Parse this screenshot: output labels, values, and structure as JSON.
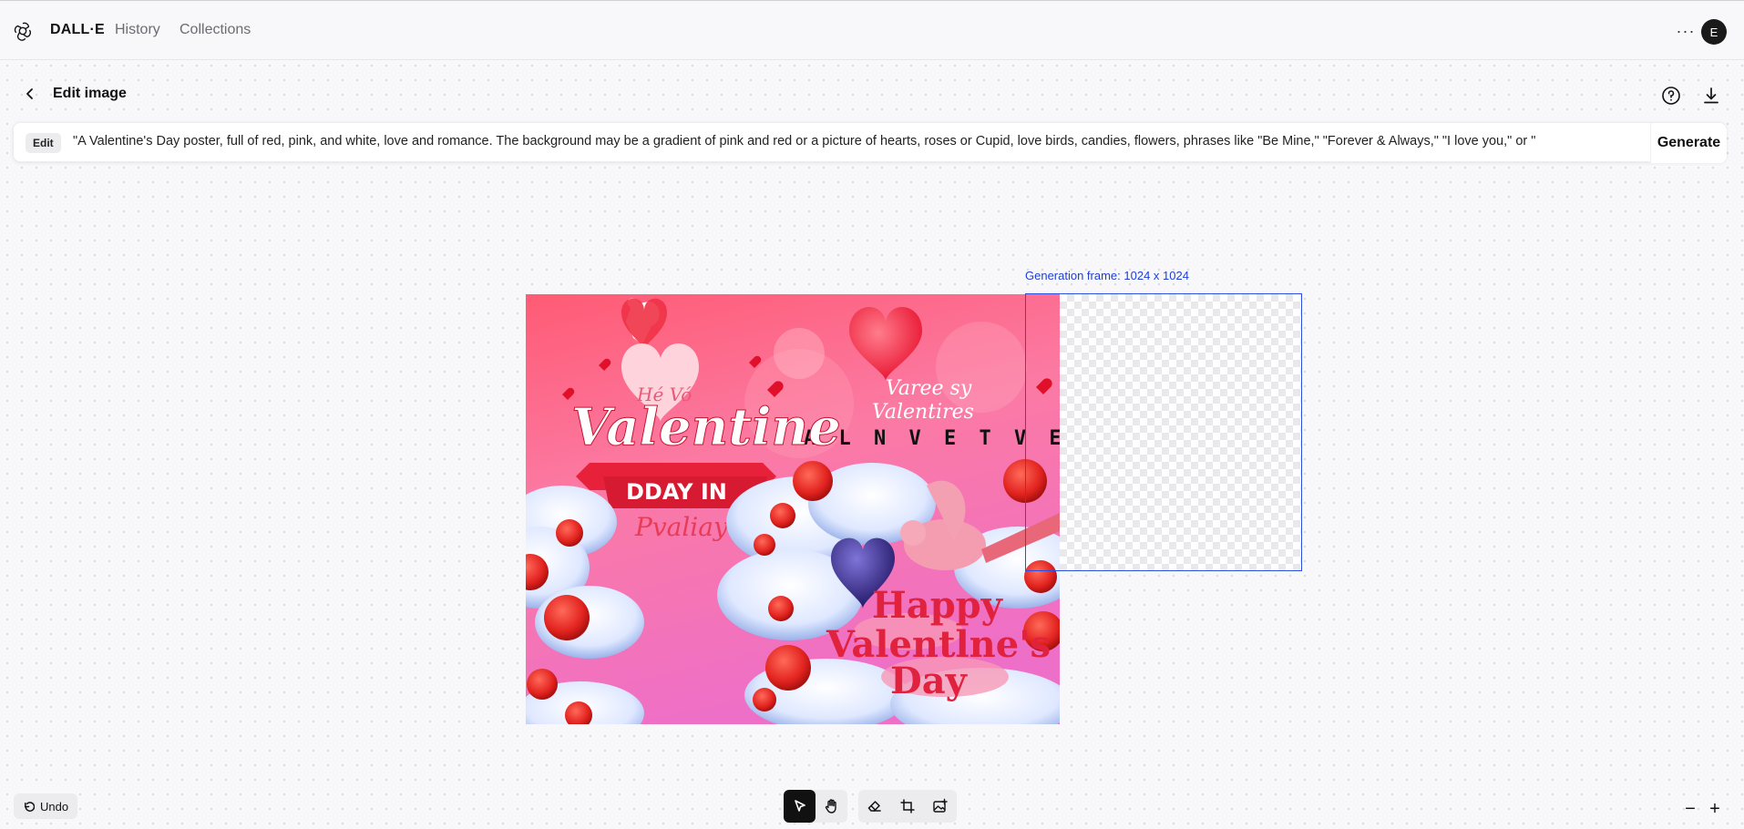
{
  "nav": {
    "brand": "DALL·E",
    "history": "History",
    "collections": "Collections",
    "more": "···",
    "avatar_initial": "E"
  },
  "editor": {
    "title": "Edit image",
    "prompt_chip": "Edit",
    "prompt_text": "\"A Valentine's Day poster, full of red, pink, and white, love and romance. The background may be a gradient of pink and red or a picture of hearts, roses or Cupid, love birds, candies, flowers, phrases like \"Be Mine,\" \"Forever & Always,\" \"I love you,\" or \"",
    "generate": "Generate",
    "generation_frame_label": "Generation frame: 1024 x 1024"
  },
  "poster": {
    "heart_text": "Hé Vó",
    "script_top": "Varee sy",
    "script_bottom": "Valentires",
    "letters": "A L N V E T  V E F R",
    "title": "Valentine",
    "ribbon": "DDAY IN",
    "script_small": "Pvaliay",
    "happy_line1": "Happy",
    "happy_line2": "Valentlne's",
    "happy_line3": "Day"
  },
  "bottom": {
    "undo": "Undo",
    "zoom_out": "−",
    "zoom_in": "+"
  },
  "colors": {
    "accent_blue": "#2b4fe0",
    "poster_red": "#e0223f",
    "poster_pink": "#f56aa8"
  }
}
